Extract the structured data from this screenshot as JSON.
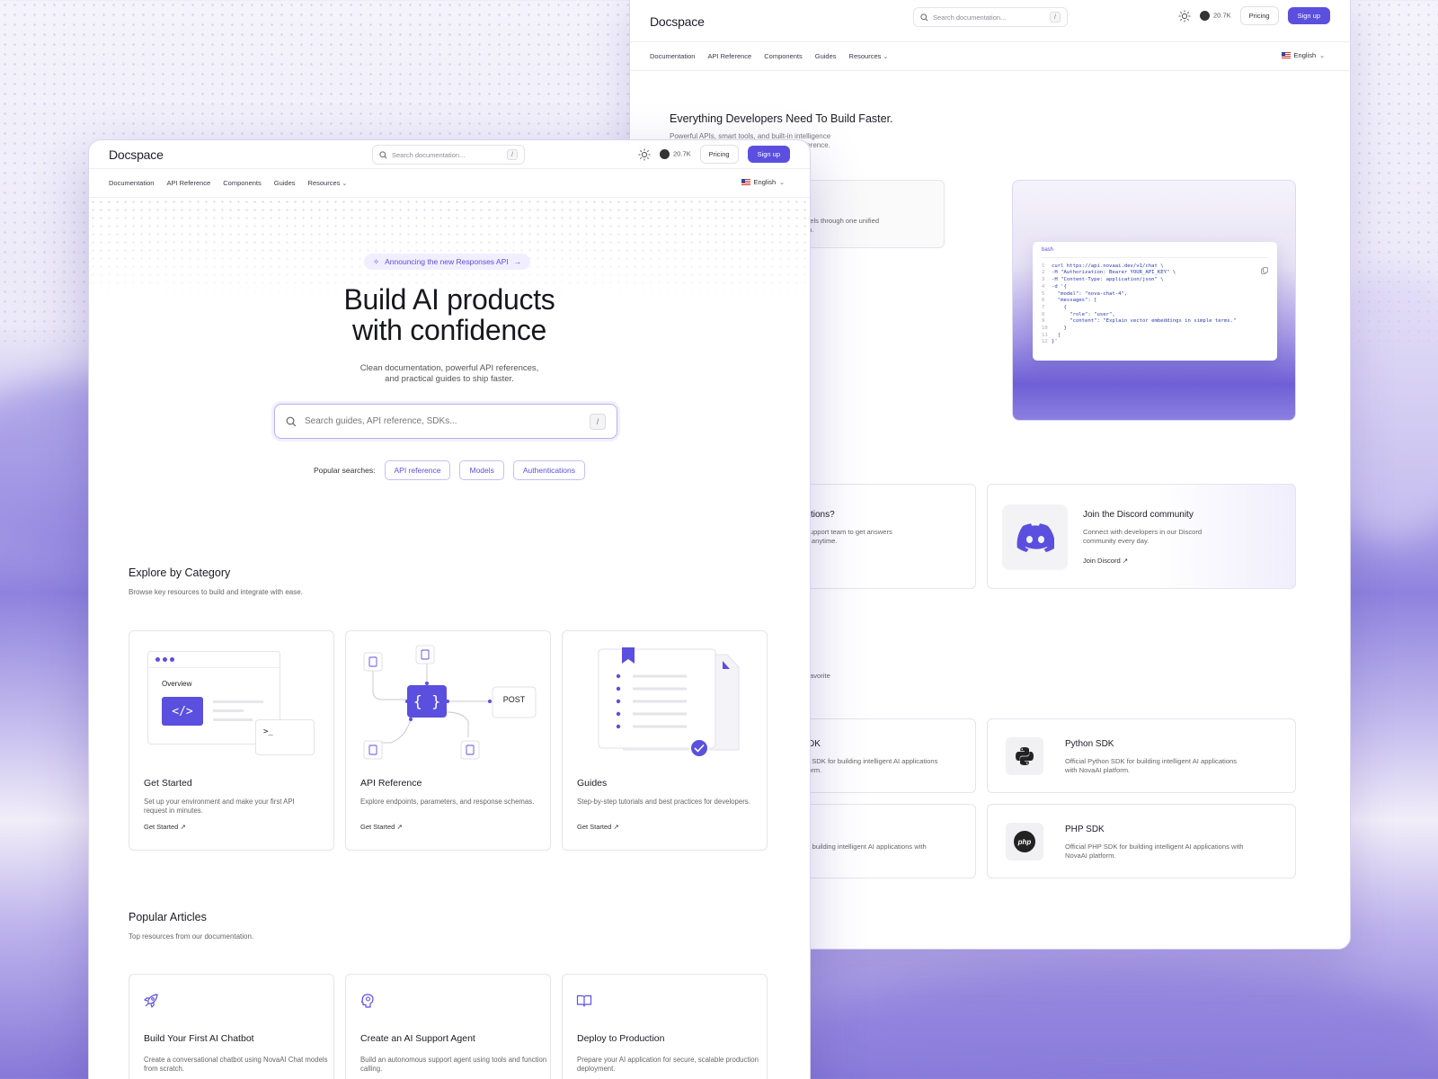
{
  "colors": {
    "accent": "#5b4fe0",
    "accent_soft": "#f1efff",
    "text": "#1b1b24"
  },
  "common": {
    "logo": "Docspace",
    "search_placeholder": "Search documentation...",
    "search_key": "/",
    "github_count": "20.7K",
    "pricing": "Pricing",
    "signup": "Sign up",
    "nav": [
      "Documentation",
      "API Reference",
      "Components",
      "Guides",
      "Resources"
    ],
    "language": "English"
  },
  "front": {
    "announcement": "Announcing the new Responses API",
    "hero_title_1": "Build AI products",
    "hero_title_2": "with confidence",
    "hero_sub_1": "Clean documentation, powerful API references,",
    "hero_sub_2": "and practical guides to ship faster.",
    "big_search_placeholder": "Search guides, API reference, SDKs...",
    "popular_label": "Popular searches:",
    "popular": [
      "API reference",
      "Models",
      "Authentications"
    ],
    "explore_title": "Explore by Category",
    "explore_sub": "Browse key resources to build and integrate with ease.",
    "categories": [
      {
        "title": "Get Started",
        "desc": "Set up your environment and make your first API request in minutes.",
        "link": "Get Started",
        "ill_label": "Overview"
      },
      {
        "title": "API Reference",
        "desc": "Explore endpoints, parameters, and response schemas.",
        "link": "Get Started",
        "ill_label": "POST"
      },
      {
        "title": "Guides",
        "desc": "Step-by-step tutorials and best practices for developers.",
        "link": "Get Started"
      }
    ],
    "articles_title": "Popular Articles",
    "articles_sub": "Top resources from our documentation.",
    "articles": [
      {
        "title": "Build Your First AI Chatbot",
        "desc": "Create a conversational chatbot using NovaAI Chat models from scratch.",
        "icon": "rocket-icon"
      },
      {
        "title": "Create an AI Support Agent",
        "desc": "Build an autonomous support agent using tools and function calling.",
        "icon": "brain-icon"
      },
      {
        "title": "Deploy to Production",
        "desc": "Prepare your AI application for secure, scalable production deployment.",
        "icon": "book-icon"
      }
    ]
  },
  "back": {
    "title": "Everything Developers Need To Build Faster.",
    "sub_1": "Powerful APIs, smart tools, and built-in intelligence",
    "sub_2": "ference.",
    "frag_1": "dels through one unified",
    "frag_2": "m.",
    "code_tab": "bash",
    "code_lines": [
      "curl https://api.novaai.dev/v1/chat \\",
      "-H \"Authorization: Bearer YOUR_API_KEY\" \\",
      "-H \"Content-Type: application/json\" \\",
      "-d '{",
      "  \"model\": \"nova-chat-4\",",
      "  \"messages\": [",
      "    {",
      "      \"role\": \"user\",",
      "      \"content\": \"Explain vector embeddings in simple terms.\"",
      "    }",
      "  ]",
      "}'"
    ],
    "support_frag_title": "stions?",
    "support_frag_1": "support team to get answers",
    "support_frag_2": "s anytime.",
    "discord_title": "Join the Discord community",
    "discord_desc_1": "Connect with developers in our Discord",
    "discord_desc_2": "community every day.",
    "discord_link": "Join Discord",
    "sdk_frag": "avorite",
    "sdk_left_1_title": "DK",
    "sdk_left_1_1": "t SDK for building intelligent AI applications",
    "sdk_left_1_2": "orm.",
    "sdk_left_2_1": "r building intelligent AI applications with",
    "python_title": "Python SDK",
    "python_desc_1": "Official Python SDK for building intelligent AI applications",
    "python_desc_2": "with NovaAI platform.",
    "php_title": "PHP SDK",
    "php_desc_1": "Official PHP SDK for building intelligent AI applications with",
    "php_desc_2": "NovaAI platform.",
    "php_badge": "php"
  }
}
